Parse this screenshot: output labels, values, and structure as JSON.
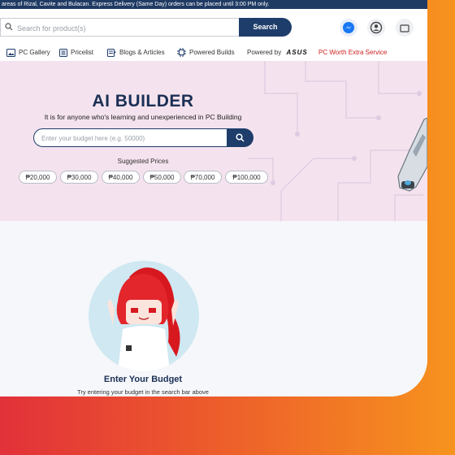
{
  "topbar": {
    "notice": "areas of Rizal, Cavite and Bulacan. Express Delivery (Same Day) orders can be placed until 3:00 PM only."
  },
  "header": {
    "search_placeholder": "Search for product(s)",
    "search_button": "Search",
    "icons": [
      "messenger-icon",
      "account-icon",
      "cart-icon"
    ]
  },
  "nav": {
    "items": [
      {
        "label": "PC Gallery",
        "icon": "gallery-icon"
      },
      {
        "label": "Pricelist",
        "icon": "list-icon"
      },
      {
        "label": "Blogs & Articles",
        "icon": "blog-icon"
      },
      {
        "label": "Powered Builds",
        "icon": "chip-icon"
      },
      {
        "label": "Powered by",
        "brand": "ASUS"
      },
      {
        "label": "PC Worth Extra Service"
      }
    ]
  },
  "hero": {
    "title": "AI BUILDER",
    "subtitle": "It is for anyone who's learning and unexperienced in PC Building",
    "budget_placeholder": "Enter your budget here (e.g. 50000)",
    "suggested_label": "Suggested Prices",
    "suggested_prices": [
      "₱20,000",
      "₱30,000",
      "₱40,000",
      "₱50,000",
      "₱70,000",
      "₱100,000"
    ]
  },
  "empty_state": {
    "title": "Enter Your Budget",
    "subtitle": "Try entering your budget in the search bar above"
  },
  "colors": {
    "navy": "#1e3d6b",
    "hero_bg": "#f4e3ee",
    "accent_red": "#d0201f",
    "gradient_start": "#e2313a",
    "gradient_end": "#f7931e"
  }
}
